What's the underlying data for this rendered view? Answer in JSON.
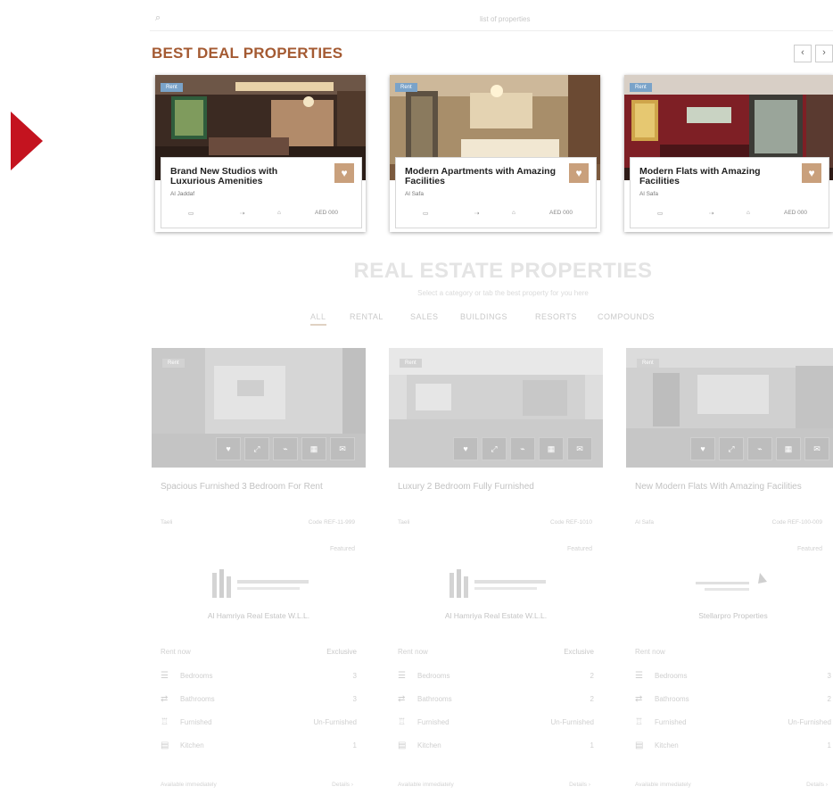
{
  "search": {
    "placeholder": "list of properties"
  },
  "best_deal": {
    "title": "BEST DEAL PROPERTIES",
    "prev_label": "‹",
    "next_label": "›",
    "cards": [
      {
        "badge": "Rent",
        "name": "Brand New Studios with Luxurious Amenities",
        "location": "Al Jaddaf",
        "area": "AED 000"
      },
      {
        "badge": "Rent",
        "name": "Modern Apartments with Amazing Facilities",
        "location": "Al Safa",
        "area": "AED 000"
      },
      {
        "badge": "Rent",
        "name": "Modern Flats with Amazing Facilities",
        "location": "Al Safa",
        "area": "AED 000"
      }
    ]
  },
  "real_estate": {
    "title": "REAL ESTATE PROPERTIES",
    "subtitle": "Select a category or tab the best property for you here",
    "tabs": [
      "ALL",
      "RENTAL",
      "SALES",
      "BUILDINGS",
      "RESORTS",
      "COMPOUNDS"
    ]
  },
  "properties": [
    {
      "badge": "Rent",
      "name": "Spacious Furnished 3 Bedroom For Rent",
      "location": "Taeli",
      "ref": "Code REF-11-999",
      "tag": "Featured",
      "agency": "Al Hamriya Real Estate W.L.L.",
      "status_label": "Rent now",
      "exclusive": "Exclusive",
      "rows": [
        {
          "label": "Bedrooms",
          "value": "3",
          "icon": "bed-icon"
        },
        {
          "label": "Bathrooms",
          "value": "3",
          "icon": "bath-icon"
        },
        {
          "label": "Furnished",
          "value": "Un-Furnished",
          "icon": "sofa-icon"
        },
        {
          "label": "Kitchen",
          "value": "1",
          "icon": "kitchen-icon"
        }
      ],
      "footer_left": "Available immediately",
      "footer_right": "Details ›"
    },
    {
      "badge": "Rent",
      "name": "Luxury 2 Bedroom Fully Furnished",
      "location": "Taeli",
      "ref": "Code REF-1010",
      "tag": "Featured",
      "agency": "Al Hamriya Real Estate W.L.L.",
      "status_label": "Rent now",
      "exclusive": "Exclusive",
      "rows": [
        {
          "label": "Bedrooms",
          "value": "2",
          "icon": "bed-icon"
        },
        {
          "label": "Bathrooms",
          "value": "2",
          "icon": "bath-icon"
        },
        {
          "label": "Furnished",
          "value": "Un-Furnished",
          "icon": "sofa-icon"
        },
        {
          "label": "Kitchen",
          "value": "1",
          "icon": "kitchen-icon"
        }
      ],
      "footer_left": "Available immediately",
      "footer_right": "Details ›"
    },
    {
      "badge": "Rent",
      "name": "New Modern Flats With Amazing Facilities",
      "location": "Al Safa",
      "ref": "Code REF-100-009",
      "tag": "Featured",
      "agency": "Stellarpro Properties",
      "status_label": "Rent now",
      "exclusive": "",
      "rows": [
        {
          "label": "Bedrooms",
          "value": "3",
          "icon": "bed-icon"
        },
        {
          "label": "Bathrooms",
          "value": "2",
          "icon": "bath-icon"
        },
        {
          "label": "Furnished",
          "value": "Un-Furnished",
          "icon": "sofa-icon"
        },
        {
          "label": "Kitchen",
          "value": "1",
          "icon": "kitchen-icon"
        }
      ],
      "footer_left": "Available immediately",
      "footer_right": "Details ›"
    }
  ],
  "colors": {
    "accent": "#a45a32",
    "play_red": "#c4131f",
    "fav_tan": "#c9a07c",
    "badge_blue": "#7aa3c9"
  }
}
